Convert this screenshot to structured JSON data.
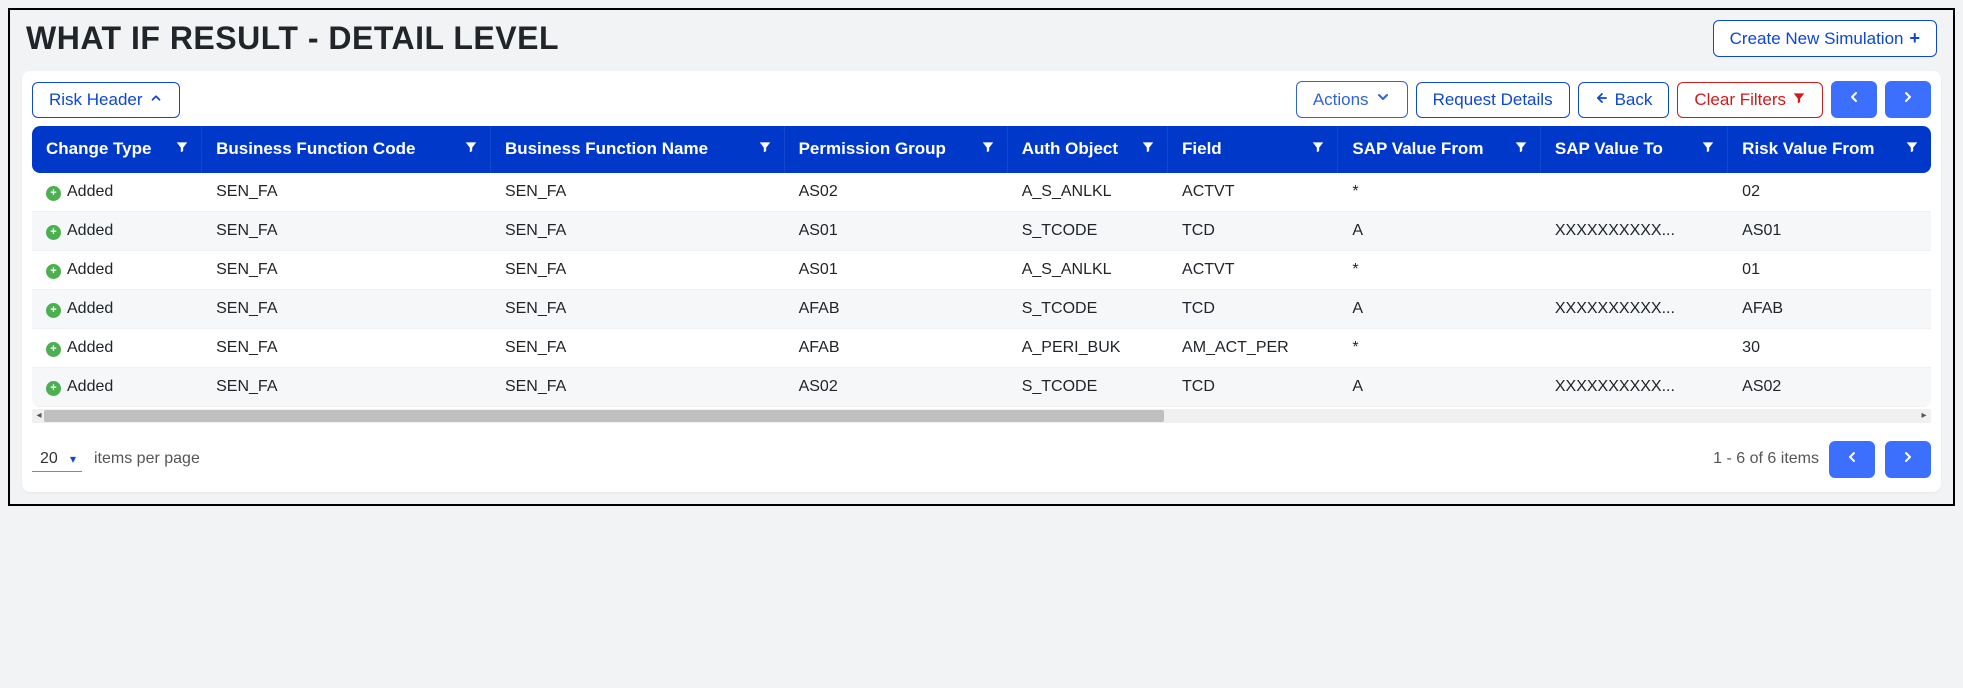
{
  "header": {
    "title": "WHAT IF RESULT - DETAIL LEVEL",
    "create_label": "Create New Simulation"
  },
  "toolbar": {
    "risk_header_label": "Risk Header",
    "actions_label": "Actions",
    "request_details_label": "Request Details",
    "back_label": "Back",
    "clear_filters_label": "Clear Filters"
  },
  "table": {
    "columns": [
      "Change Type",
      "Business Function Code",
      "Business Function Name",
      "Permission Group",
      "Auth Object",
      "Field",
      "SAP Value From",
      "SAP Value To",
      "Risk Value From"
    ],
    "rows": [
      {
        "change_type": "Added",
        "bfc": "SEN_FA",
        "bfn": "SEN_FA",
        "pg": "AS02",
        "auth": "A_S_ANLKL",
        "field": "ACTVT",
        "svf": "*",
        "svt": "",
        "rvf": "02"
      },
      {
        "change_type": "Added",
        "bfc": "SEN_FA",
        "bfn": "SEN_FA",
        "pg": "AS01",
        "auth": "S_TCODE",
        "field": "TCD",
        "svf": "A",
        "svt": "XXXXXXXXXX...",
        "rvf": "AS01"
      },
      {
        "change_type": "Added",
        "bfc": "SEN_FA",
        "bfn": "SEN_FA",
        "pg": "AS01",
        "auth": "A_S_ANLKL",
        "field": "ACTVT",
        "svf": "*",
        "svt": "",
        "rvf": "01"
      },
      {
        "change_type": "Added",
        "bfc": "SEN_FA",
        "bfn": "SEN_FA",
        "pg": "AFAB",
        "auth": "S_TCODE",
        "field": "TCD",
        "svf": "A",
        "svt": "XXXXXXXXXX...",
        "rvf": "AFAB"
      },
      {
        "change_type": "Added",
        "bfc": "SEN_FA",
        "bfn": "SEN_FA",
        "pg": "AFAB",
        "auth": "A_PERI_BUK",
        "field": "AM_ACT_PER",
        "svf": "*",
        "svt": "",
        "rvf": "30"
      },
      {
        "change_type": "Added",
        "bfc": "SEN_FA",
        "bfn": "SEN_FA",
        "pg": "AS02",
        "auth": "S_TCODE",
        "field": "TCD",
        "svf": "A",
        "svt": "XXXXXXXXXX...",
        "rvf": "AS02"
      }
    ]
  },
  "footer": {
    "page_size": "20",
    "items_per_page_label": "items per page",
    "range_label": "1 - 6 of 6 items"
  }
}
